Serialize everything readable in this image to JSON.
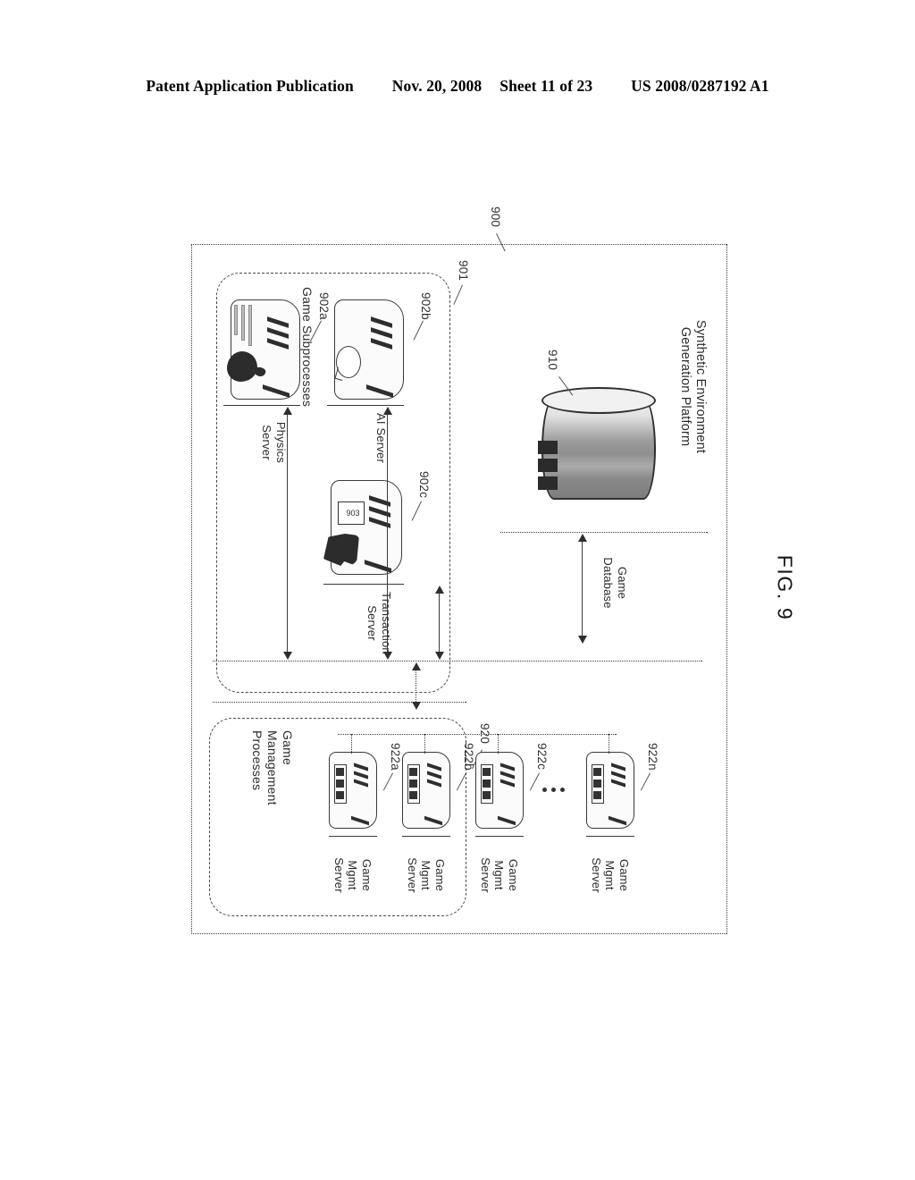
{
  "header": {
    "publication": "Patent Application Publication",
    "date": "Nov. 20, 2008",
    "sheet": "Sheet 11 of 23",
    "patent_number": "US 2008/0287192 A1"
  },
  "figure": {
    "caption": "FIG. 9",
    "platform_title": "Synthetic Environment Generation Platform",
    "refs": {
      "system": "900",
      "subprocesses_zone": "901",
      "physics_server": "902a",
      "ai_server": "902b",
      "transaction_server": "902c",
      "transaction_inset": "903",
      "game_database": "910",
      "mgmt_zone": "920",
      "mgmt_server_a": "922a",
      "mgmt_server_b": "922b",
      "mgmt_server_c": "922c",
      "mgmt_server_n": "922n"
    },
    "zones": {
      "subprocesses_label": "Game Subprocesses",
      "mgmt_label": "Game Management Processes"
    },
    "nodes": {
      "game_database": "Game Database",
      "physics_server": "Physics Server",
      "ai_server": "AI Server",
      "transaction_server": "Transaction Server",
      "mgmt_server": "Game Mgmt Server"
    }
  }
}
